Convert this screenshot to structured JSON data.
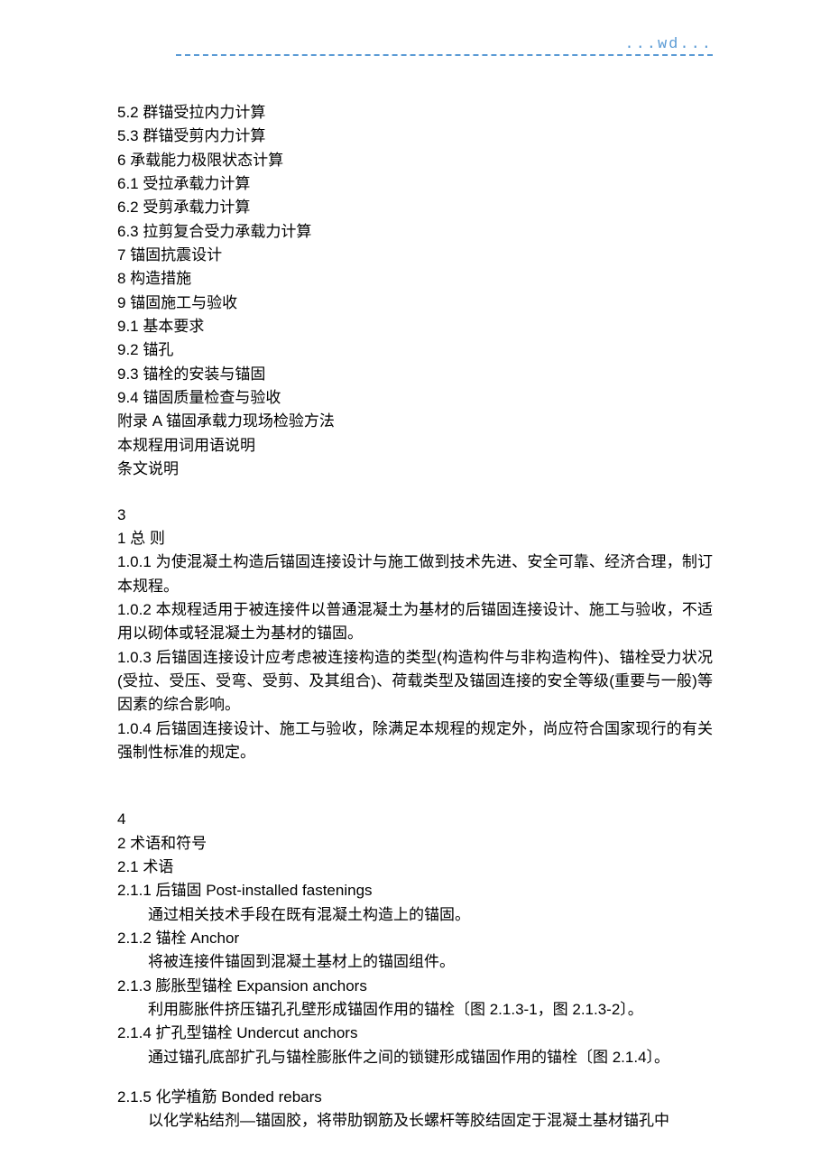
{
  "header": {
    "wd": "...wd..."
  },
  "toc": [
    "5.2 群锚受拉内力计算",
    "5.3 群锚受剪内力计算",
    "6 承载能力极限状态计算",
    "6.1 受拉承载力计算",
    "6.2 受剪承载力计算",
    "6.3 拉剪复合受力承载力计算",
    "7 锚固抗震设计",
    "8 构造措施",
    "9 锚固施工与验收",
    "9.1    基本要求",
    "9.2 锚孔",
    "9.3 锚栓的安装与锚固",
    "9.4 锚固质量检查与验收",
    "附录 A  锚固承载力现场检验方法",
    "本规程用词用语说明",
    "条文说明"
  ],
  "section3": {
    "page": " 3",
    "heading": "1  总 则",
    "paras": [
      "1.0.1  为使混凝土构造后锚固连接设计与施工做到技术先进、安全可靠、经济合理，制订本规程。",
      "1.0.2  本规程适用于被连接件以普通混凝土为基材的后锚固连接设计、施工与验收，不适用以砌体或轻混凝土为基材的锚固。",
      "1.0.3  后锚固连接设计应考虑被连接构造的类型(构造构件与非构造构件)、锚栓受力状况(受拉、受压、受弯、受剪、及其组合)、荷载类型及锚固连接的安全等级(重要与一般)等因素的综合影响。",
      "1.0.4  后锚固连接设计、施工与验收，除满足本规程的规定外，尚应符合国家现行的有关强制性标准的规定。"
    ]
  },
  "section4": {
    "page": " 4",
    "heading": "2  术语和符号",
    "subheading": "2.1  术语",
    "terms": [
      {
        "title": "2.1.1  后锚固 Post-installed fastenings",
        "def": "通过相关技术手段在既有混凝土构造上的锚固。"
      },
      {
        "title": "2.1.2  锚栓 Anchor",
        "def": "将被连接件锚固到混凝土基材上的锚固组件。"
      },
      {
        "title": "2.1.3  膨胀型锚栓 Expansion anchors",
        "def": "利用膨胀件挤压锚孔孔壁形成锚固作用的锚栓〔图 2.1.3-1，图 2.1.3-2〕。"
      },
      {
        "title": "2.1.4  扩孔型锚栓 Undercut anchors",
        "def": "通过锚孔底部扩孔与锚栓膨胀件之间的锁键形成锚固作用的锚栓〔图 2.1.4〕。"
      }
    ],
    "term5": {
      "title": "2.1.5  化学植筋 Bonded rebars",
      "def": "以化学粘结剂—锚固胶，将带肋钢筋及长螺杆等胶结固定于混凝土基材锚孔中"
    }
  }
}
